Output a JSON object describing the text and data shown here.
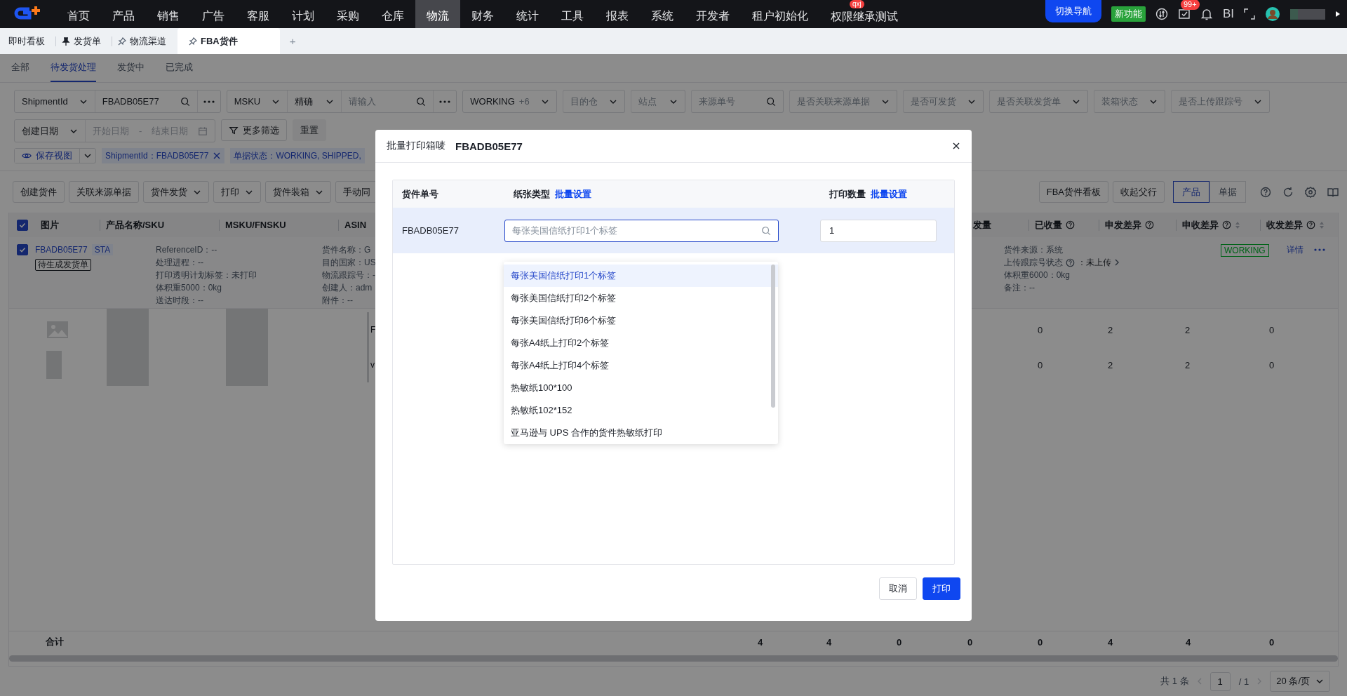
{
  "top_nav": {
    "menu": [
      {
        "label": "首页",
        "selected": false
      },
      {
        "label": "产品",
        "selected": false
      },
      {
        "label": "销售",
        "selected": false
      },
      {
        "label": "广告",
        "selected": false
      },
      {
        "label": "客服",
        "selected": false
      },
      {
        "label": "计划",
        "selected": false
      },
      {
        "label": "采购",
        "selected": false
      },
      {
        "label": "仓库",
        "selected": false
      },
      {
        "label": "物流",
        "selected": true
      },
      {
        "label": "财务",
        "selected": false
      },
      {
        "label": "统计",
        "selected": false
      },
      {
        "label": "工具",
        "selected": false
      },
      {
        "label": "报表",
        "selected": false
      },
      {
        "label": "系统",
        "selected": false
      },
      {
        "label": "开发者",
        "selected": false
      },
      {
        "label": "租户初始化",
        "selected": false
      },
      {
        "label": "权限继承测试",
        "selected": false,
        "badge": "qxj"
      }
    ],
    "switch_button": "切换导航",
    "new_feature": "新功能",
    "notification_count": "99+",
    "bi": "BI"
  },
  "page_tabs": [
    {
      "label": "即时看板",
      "kind": "plain",
      "selected": false
    },
    {
      "label": "发货单",
      "kind": "pinned",
      "selected": false
    },
    {
      "label": "物流渠道",
      "kind": "unpinned",
      "selected": false
    },
    {
      "label": "FBA货件",
      "kind": "unpinned",
      "selected": true
    }
  ],
  "add_tab": "+",
  "status_tabs": [
    {
      "label": "全部",
      "selected": false
    },
    {
      "label": "待发货处理",
      "selected": true
    },
    {
      "label": "发货中",
      "selected": false
    },
    {
      "label": "已完成",
      "selected": false
    }
  ],
  "filter_rows": [
    [
      {
        "parts": [
          {
            "kind": "select",
            "label": "ShipmentId"
          },
          {
            "kind": "search",
            "value": "FBADB05E77"
          },
          {
            "kind": "more"
          }
        ]
      },
      {
        "parts": [
          {
            "kind": "select",
            "label": "MSKU"
          },
          {
            "kind": "select",
            "label": "精确"
          },
          {
            "kind": "search",
            "placeholder": "请输入"
          },
          {
            "kind": "more"
          }
        ]
      },
      {
        "parts": [
          {
            "kind": "select",
            "label": "WORKING",
            "count": "+6"
          }
        ]
      },
      {
        "parts": [
          {
            "kind": "select",
            "placeholder": "目的仓"
          }
        ]
      },
      {
        "parts": [
          {
            "kind": "select",
            "placeholder": "站点"
          }
        ]
      },
      {
        "parts": [
          {
            "kind": "search",
            "placeholder": "来源单号"
          }
        ]
      },
      {
        "parts": [
          {
            "kind": "select",
            "placeholder": "是否关联来源单据"
          }
        ]
      },
      {
        "parts": [
          {
            "kind": "select",
            "placeholder": "是否可发货"
          }
        ]
      },
      {
        "parts": [
          {
            "kind": "select",
            "placeholder": "是否关联发货单"
          }
        ]
      },
      {
        "parts": [
          {
            "kind": "select",
            "placeholder": "装箱状态"
          }
        ]
      },
      {
        "parts": [
          {
            "kind": "select",
            "placeholder": "是否上传跟踪号"
          }
        ]
      }
    ],
    [
      {
        "parts": [
          {
            "kind": "select",
            "label": "创建日期"
          },
          {
            "kind": "date_range",
            "start_placeholder": "开始日期",
            "separator": "-",
            "end_placeholder": "结束日期"
          }
        ]
      },
      {
        "parts": [
          {
            "kind": "filter_button",
            "label": "更多筛选"
          }
        ]
      },
      {
        "parts": [
          {
            "kind": "muted_button",
            "label": "重置"
          }
        ]
      }
    ]
  ],
  "view_bar": {
    "save_view": "保存视图",
    "tags": [
      {
        "text": "ShipmentId：FBADB05E77",
        "closable": true
      },
      {
        "text": "单据状态：WORKING, SHIPPED,",
        "closable": false
      }
    ]
  },
  "toolbar": {
    "left": [
      {
        "label": "创建货件",
        "dropdown": false
      },
      {
        "label": "关联来源单据",
        "dropdown": false
      },
      {
        "label": "货件发货",
        "dropdown": true
      },
      {
        "label": "打印",
        "dropdown": true
      },
      {
        "label": "货件装箱",
        "dropdown": true
      },
      {
        "label": "手动同",
        "dropdown": false
      }
    ],
    "right": [
      "FBA货件看板",
      "收起父行"
    ],
    "view_toggle": [
      {
        "label": "产品",
        "selected": true
      },
      {
        "label": "单据",
        "selected": false
      }
    ]
  },
  "table": {
    "header_checked": true,
    "left_columns": [
      "图片",
      "产品名称/SKU",
      "MSKU/FNSKU",
      "ASIN"
    ],
    "right_columns": [
      {
        "label": "发量",
        "help": false,
        "sortable": false
      },
      {
        "label": "已收量",
        "help": true,
        "sortable": false
      },
      {
        "label": "申发差异",
        "help": true,
        "sortable": false
      },
      {
        "label": "申收差异",
        "help": true,
        "sortable": true
      },
      {
        "label": "收发差异",
        "help": true,
        "sortable": true
      }
    ],
    "shipment": {
      "checked": true,
      "id": "FBADB05E77",
      "tag": "STA",
      "action": "待生成发货单",
      "details_1": [
        "ReferenceID：--",
        "处理进程：--",
        "打印透明计划标签：未打印",
        "体积重5000：0kg",
        "送达时段：--"
      ],
      "details_2": [
        "货件名称：G",
        "目的国家：US",
        "物流跟踪号：-",
        "创建人：adm",
        "附件：--"
      ],
      "details_3": [
        {
          "label": "货件来源：系统"
        },
        {
          "label": "上传跟踪号状态",
          "help": true,
          "value": "：未上传",
          "arrow": true
        },
        {
          "label": "体积重6000：0kg"
        },
        {
          "label": "备注：--"
        }
      ],
      "status": "WORKING",
      "detail_link": "详情"
    },
    "lines": [
      {
        "fragment": "F",
        "values": [
          "0",
          "2",
          "2",
          "0"
        ]
      },
      {
        "fragment": "v",
        "values": [
          "0",
          "2",
          "2",
          "0"
        ]
      }
    ],
    "totals": {
      "label": "合计",
      "values": [
        "4",
        "4",
        "0",
        "0",
        "0",
        "4",
        "4",
        "0"
      ]
    }
  },
  "pagination": {
    "total": "共 1 条",
    "page": "1",
    "pages": "/ 1",
    "page_size": "20 条/页"
  },
  "modal": {
    "title": "批量打印箱唛",
    "shipment_id": "FBADB05E77",
    "columns": [
      {
        "label": "货件单号"
      },
      {
        "label": "纸张类型",
        "action": "批量设置"
      },
      {
        "label": "打印数量",
        "action": "批量设置"
      }
    ],
    "rows": [
      {
        "shipment": "FBADB05E77",
        "paper_placeholder": "每张美国信纸打印1个标签",
        "quantity": "1",
        "highlighted": true,
        "dropdown_open": true
      }
    ],
    "paper_options": [
      {
        "label": "每张美国信纸打印1个标签",
        "selected": true
      },
      {
        "label": "每张美国信纸打印2个标签",
        "selected": false
      },
      {
        "label": "每张美国信纸打印6个标签",
        "selected": false
      },
      {
        "label": "每张A4纸上打印2个标签",
        "selected": false
      },
      {
        "label": "每张A4纸上打印4个标签",
        "selected": false
      },
      {
        "label": "热敏纸100*100",
        "selected": false
      },
      {
        "label": "热敏纸102*152",
        "selected": false
      },
      {
        "label": "亚马逊与 UPS 合作的货件热敏纸打印",
        "selected": false
      }
    ],
    "buttons": [
      {
        "label": "取消",
        "kind": "default"
      },
      {
        "label": "打印",
        "kind": "primary"
      }
    ]
  }
}
